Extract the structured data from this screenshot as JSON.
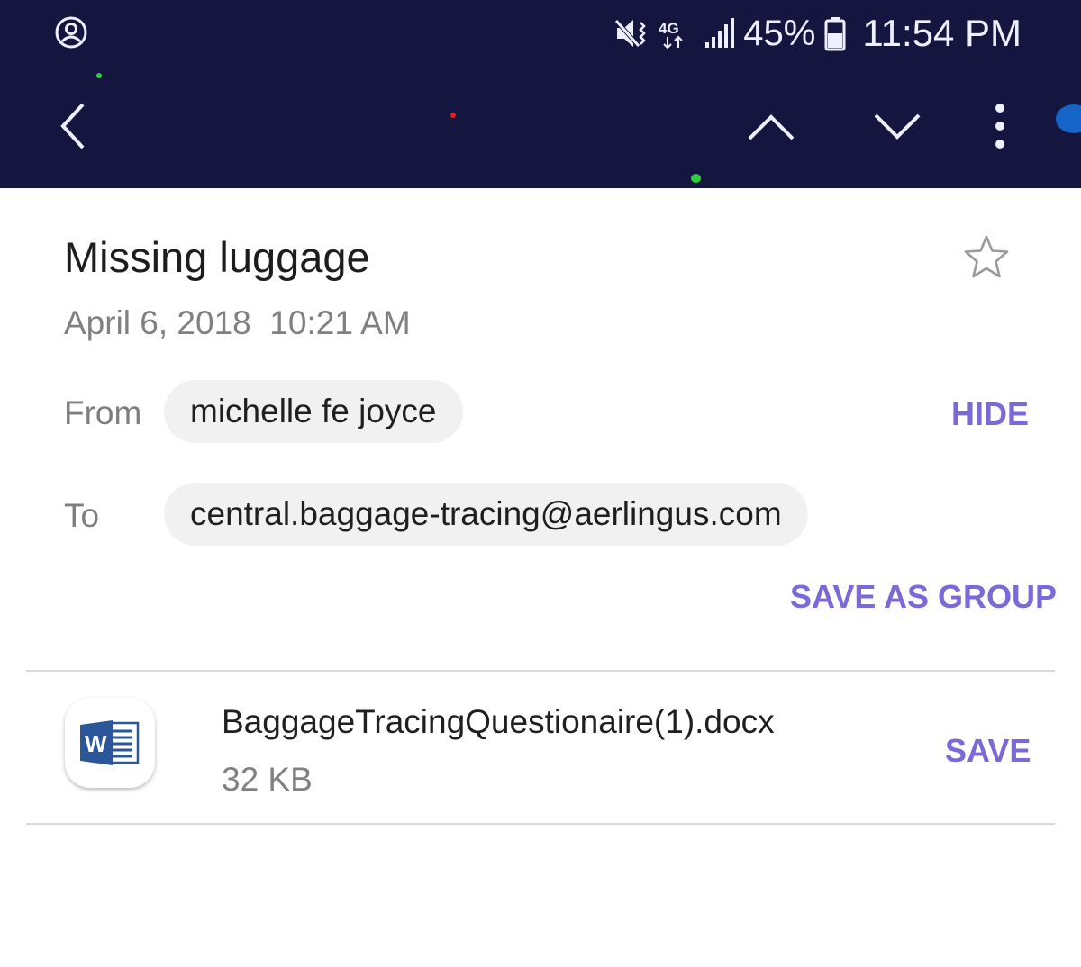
{
  "status_bar": {
    "battery": "45%",
    "time": "11:54 PM",
    "network": "4G"
  },
  "toolbar": {
    "back_icon": "chevron-left-icon",
    "prev_icon": "chevron-up-icon",
    "next_icon": "chevron-down-icon",
    "more_icon": "more-vertical-icon"
  },
  "email": {
    "subject": "Missing luggage",
    "date": "April 6, 2018  10:21 AM",
    "from_label": "From",
    "from_value": "michelle fe joyce",
    "to_label": "To",
    "to_value": "central.baggage-tracing@aerlingus.com",
    "hide_label": "HIDE",
    "save_group_label": "SAVE AS GROUP"
  },
  "attachment": {
    "icon": "word-doc-icon",
    "icon_letter": "W",
    "name": "BaggageTracingQuestionaire(1).docx",
    "size": "32 KB",
    "save_label": "SAVE"
  },
  "colors": {
    "topbar": "#141640",
    "accent": "#7a6ad8",
    "chip_bg": "#f1f1f1",
    "word_blue": "#2b579a"
  }
}
